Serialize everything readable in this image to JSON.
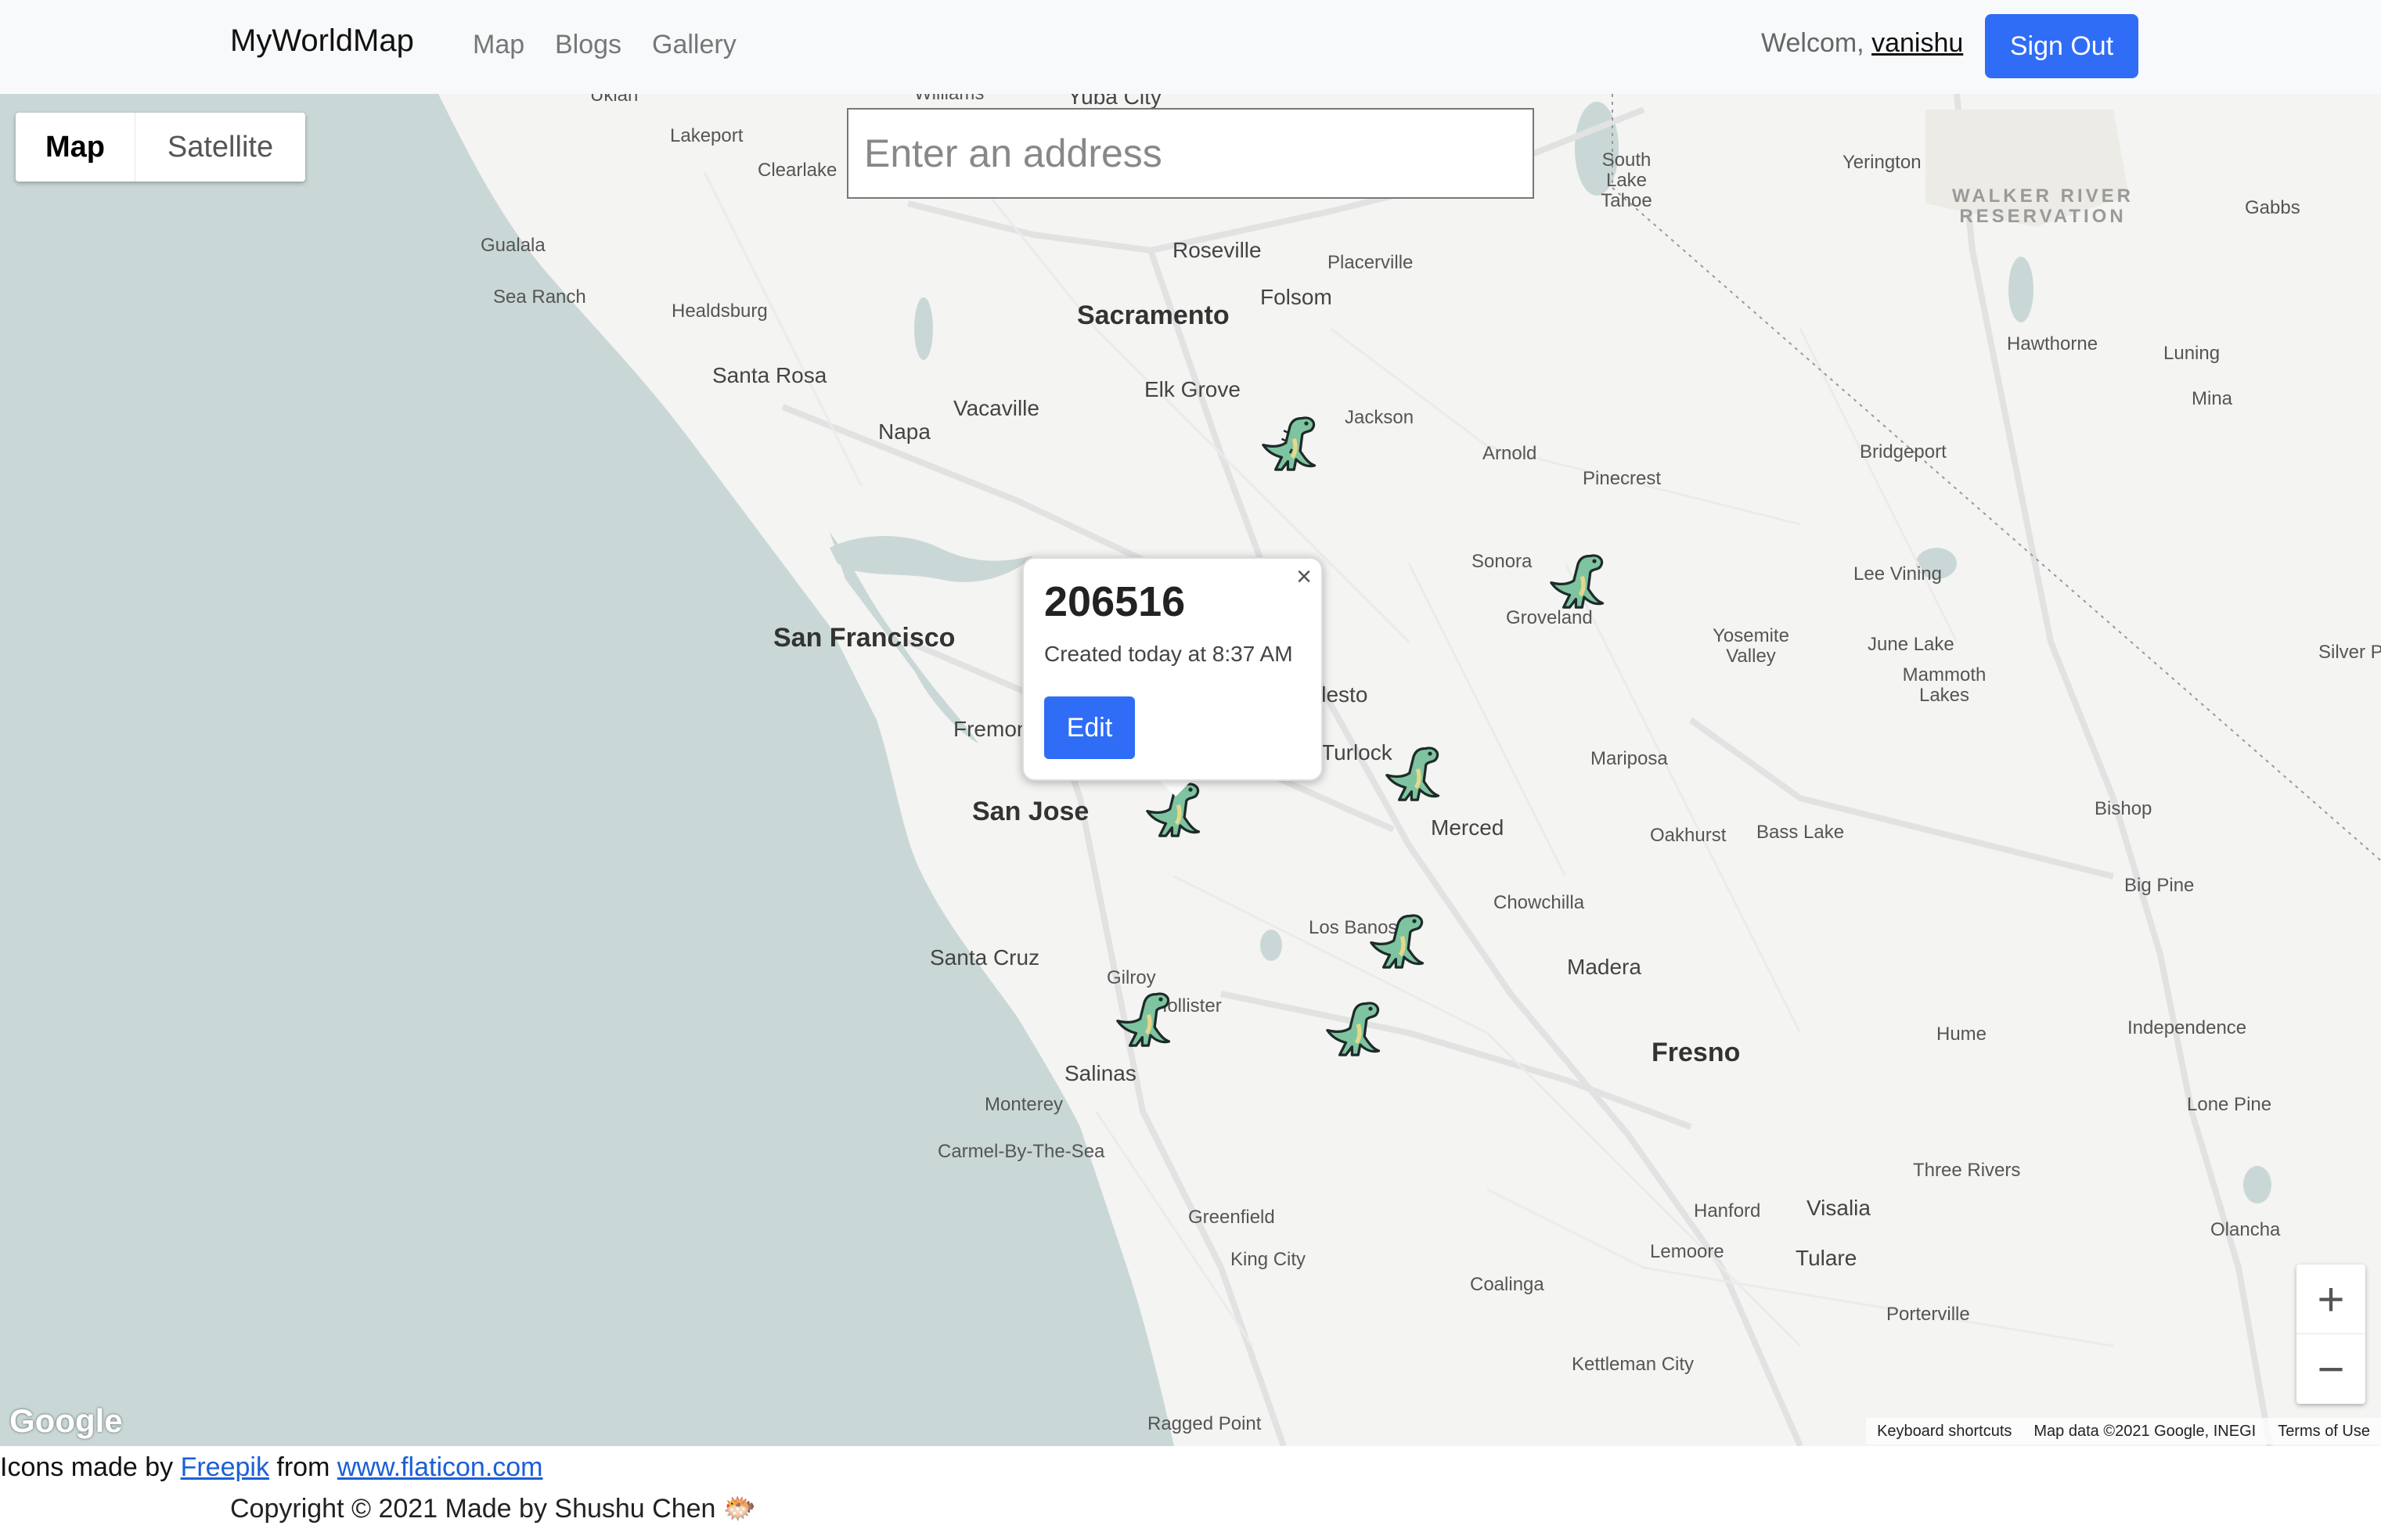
{
  "nav": {
    "brand": "MyWorldMap",
    "links": [
      "Map",
      "Blogs",
      "Gallery"
    ],
    "welcome_prefix": "Welcom,",
    "username": "vanishu",
    "signout_label": "Sign Out",
    "accent_color": "#2f6df6"
  },
  "map": {
    "type_options": [
      "Map",
      "Satellite"
    ],
    "selected_type": "Map",
    "address_placeholder": "Enter an address",
    "cities": [
      {
        "name": "Ukiah"
      },
      {
        "name": "Williams"
      },
      {
        "name": "Yuba City"
      },
      {
        "name": "Lakeport"
      },
      {
        "name": "Clearlake"
      },
      {
        "name": "Gualala"
      },
      {
        "name": "Sea Ranch"
      },
      {
        "name": "Healdsburg"
      },
      {
        "name": "Santa Rosa"
      },
      {
        "name": "Napa"
      },
      {
        "name": "Vacaville"
      },
      {
        "name": "Roseville"
      },
      {
        "name": "Placerville"
      },
      {
        "name": "Folsom"
      },
      {
        "name": "Sacramento"
      },
      {
        "name": "Elk Grove"
      },
      {
        "name": "Jackson"
      },
      {
        "name": "Arnold"
      },
      {
        "name": "Pinecrest"
      },
      {
        "name": "Sonora"
      },
      {
        "name": "Groveland"
      },
      {
        "name": "San Francisco"
      },
      {
        "name": "Fremont"
      },
      {
        "name": "San Jose"
      },
      {
        "name": "Modesto"
      },
      {
        "name": "Turlock"
      },
      {
        "name": "Merced"
      },
      {
        "name": "Mariposa"
      },
      {
        "name": "Oakhurst"
      },
      {
        "name": "Bass Lake"
      },
      {
        "name": "Yosemite Valley"
      },
      {
        "name": "Lee Vining"
      },
      {
        "name": "June Lake"
      },
      {
        "name": "Mammoth Lakes"
      },
      {
        "name": "Bridgeport"
      },
      {
        "name": "South Lake Tahoe"
      },
      {
        "name": "Yerington"
      },
      {
        "name": "Gabbs"
      },
      {
        "name": "Hawthorne"
      },
      {
        "name": "Luning"
      },
      {
        "name": "Mina"
      },
      {
        "name": "Silver Peak"
      },
      {
        "name": "Bishop"
      },
      {
        "name": "Big Pine"
      },
      {
        "name": "Independence"
      },
      {
        "name": "Lone Pine"
      },
      {
        "name": "Olancha"
      },
      {
        "name": "Three Rivers"
      },
      {
        "name": "Hume"
      },
      {
        "name": "Santa Cruz"
      },
      {
        "name": "Gilroy"
      },
      {
        "name": "Hollister"
      },
      {
        "name": "Los Banos"
      },
      {
        "name": "Chowchilla"
      },
      {
        "name": "Madera"
      },
      {
        "name": "Fresno"
      },
      {
        "name": "Salinas"
      },
      {
        "name": "Monterey"
      },
      {
        "name": "Carmel-By-The-Sea"
      },
      {
        "name": "Greenfield"
      },
      {
        "name": "King City"
      },
      {
        "name": "Coalinga"
      },
      {
        "name": "Hanford"
      },
      {
        "name": "Visalia"
      },
      {
        "name": "Lemoore"
      },
      {
        "name": "Tulare"
      },
      {
        "name": "Porterville"
      },
      {
        "name": "Kettleman City"
      },
      {
        "name": "Ragged Point"
      }
    ],
    "park_label": "WALKER RIVER RESERVATION",
    "popup": {
      "title": "206516",
      "subtitle": "Created today at 8:37 AM",
      "edit_label": "Edit",
      "close_symbol": "×"
    },
    "zoom_in": "+",
    "zoom_out": "−",
    "google_logo": "Google",
    "attribution": [
      "Keyboard shortcuts",
      "Map data ©2021 Google, INEGI",
      "Terms of Use"
    ]
  },
  "footer": {
    "icons_prefix": "Icons made by",
    "author": "Freepik",
    "from_word": "from",
    "site": "www.flaticon.com",
    "copyright": "Copyright © 2021 Made by Shushu Chen 🐡"
  },
  "colors": {
    "ocean": "#c9d8d6",
    "land": "#f4f4f2",
    "dino": "#7fc4a0"
  }
}
